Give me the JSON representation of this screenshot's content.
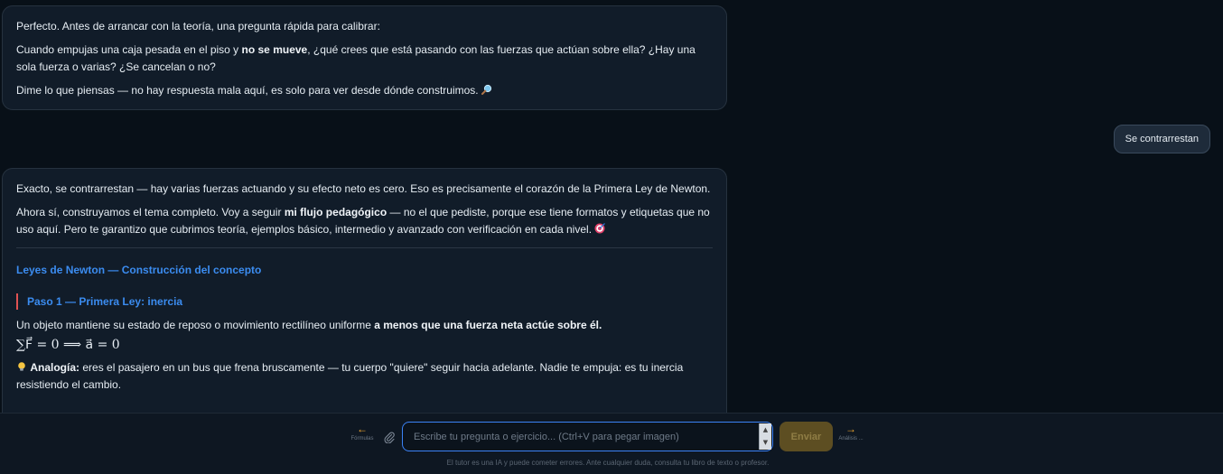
{
  "messages": {
    "first": {
      "intro": "Perfecto. Antes de arrancar con la teoría, una pregunta rápida para calibrar:",
      "q_before": "Cuando empujas una caja pesada en el piso y ",
      "q_bold": "no se mueve",
      "q_after": ", ¿qué crees que está pasando con las fuerzas que actúan sobre ella? ¿Hay una sola fuerza o varias? ¿Se cancelan o no?",
      "closing": "Dime lo que piensas — no hay respuesta mala aquí, es solo para ver desde dónde construimos.",
      "emoji_icon": "magnifier-icon"
    },
    "user_reply": "Se contrarrestan",
    "second": {
      "p1": "Exacto, se contrarrestan — hay varias fuerzas actuando y su efecto neto es cero. Eso es precisamente el corazón de la Primera Ley de Newton.",
      "p2_before": "Ahora sí, construyamos el tema completo. Voy a seguir ",
      "p2_bold": "mi flujo pedagógico",
      "p2_after": " — no el que pediste, porque ese tiene formatos y etiquetas que no uso aquí. Pero te garantizo que cubrimos teoría, ejemplos básico, intermedio y avanzado con verificación en cada nivel.",
      "emoji_icon": "target-icon",
      "section_title": "Leyes de Newton — Construcción del concepto",
      "step_title": "Paso 1 — Primera Ley: inercia",
      "law_before": "Un objeto mantiene su estado de reposo o movimiento rectilíneo uniforme ",
      "law_bold": "a menos que una fuerza neta actúe sobre él.",
      "formula": "∑F⃗ = 0 ⟹ a⃗ = 0",
      "analogy_label": "Analogía:",
      "analogy_text": " eres el pasajero en un bus que frena bruscamente — tu cuerpo \"quiere\" seguir hacia adelante. Nadie te empuja: es tu inercia resistiendo el cambio.",
      "analogy_icon": "lightbulb-icon"
    }
  },
  "composer": {
    "formulas_label": "Fórmulas",
    "formulas_icon": "arrow-left-icon",
    "attach_icon": "paperclip-icon",
    "placeholder": "Escribe tu pregunta o ejercicio... (Ctrl+V para pegar imagen)",
    "send_label": "Enviar",
    "analysis_label": "Análisis ...",
    "analysis_icon": "arrow-right-icon",
    "disclaimer": "El tutor es una IA y puede cometer errores. Ante cualquier duda, consulta tu libro de texto o profesor."
  },
  "colors": {
    "background": "#081018",
    "bubble": "#111c29",
    "accent_blue": "#3b8cf0",
    "accent_red": "#e05252",
    "accent_orange": "#f0a830",
    "send_button": "#5d4e22"
  }
}
